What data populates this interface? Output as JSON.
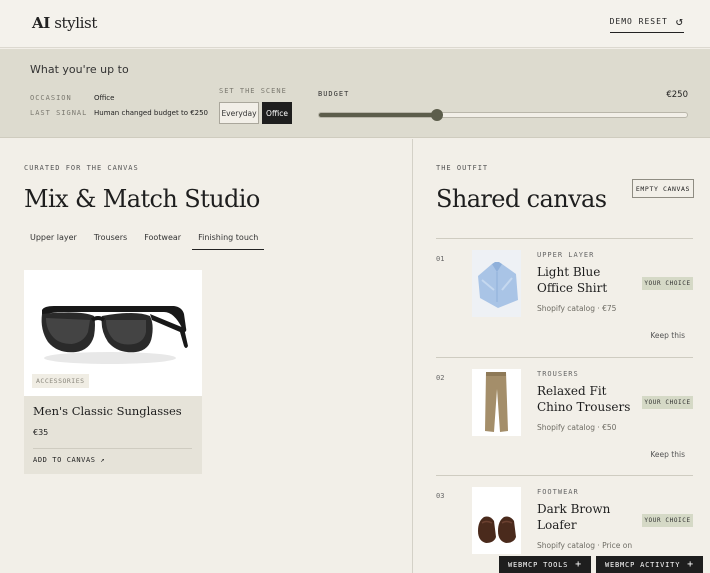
{
  "header": {
    "logo_ai": "AI",
    "logo_rest": "stylist",
    "demo_reset": "DEMO RESET",
    "reset_icon": "refresh-icon"
  },
  "context": {
    "title": "What you're up to",
    "occasion_label": "OCCASION",
    "occasion_value": "Office",
    "signal_label": "LAST SIGNAL",
    "signal_value": "Human changed budget to €250",
    "scene_label": "SET THE SCENE",
    "scene_options": [
      "Everyday",
      "Office"
    ],
    "scene_selected": "Office",
    "budget_label": "BUDGET",
    "budget_value": "€250",
    "budget_fraction": 0.32
  },
  "studio": {
    "eyebrow": "CURATED FOR THE CANVAS",
    "title": "Mix & Match Studio",
    "tabs": [
      "Upper layer",
      "Trousers",
      "Footwear",
      "Finishing touch"
    ],
    "active_tab": "Finishing touch",
    "product": {
      "tag": "ACCESSORIES",
      "name": "Men's Classic Sunglasses",
      "price": "€35",
      "add_label": "ADD TO CANVAS ↗"
    }
  },
  "canvas": {
    "eyebrow": "THE OUTFIT",
    "title": "Shared canvas",
    "empty_label": "EMPTY CANVAS",
    "items": [
      {
        "num": "01",
        "category": "UPPER LAYER",
        "name": "Light Blue Office Shirt",
        "sub": "Shopify catalog · €75",
        "badge": "YOUR CHOICE",
        "keep": "Keep this"
      },
      {
        "num": "02",
        "category": "TROUSERS",
        "name": "Relaxed Fit Chino Trousers",
        "sub": "Shopify catalog · €50",
        "badge": "YOUR CHOICE",
        "keep": "Keep this"
      },
      {
        "num": "03",
        "category": "FOOTWEAR",
        "name": "Dark Brown Loafer",
        "sub": "Shopify catalog · Price on",
        "badge": "YOUR CHOICE",
        "keep": ""
      }
    ]
  },
  "floating": {
    "tools": "WEBMCP TOOLS",
    "activity": "WEBMCP ACTIVITY",
    "plus": "+"
  },
  "colors": {
    "accent_dark": "#1e1e1e",
    "slider": "#5c5d4b",
    "badge": "#d5d9c6",
    "band": "#dddbcf",
    "background": "#f2efe8"
  }
}
